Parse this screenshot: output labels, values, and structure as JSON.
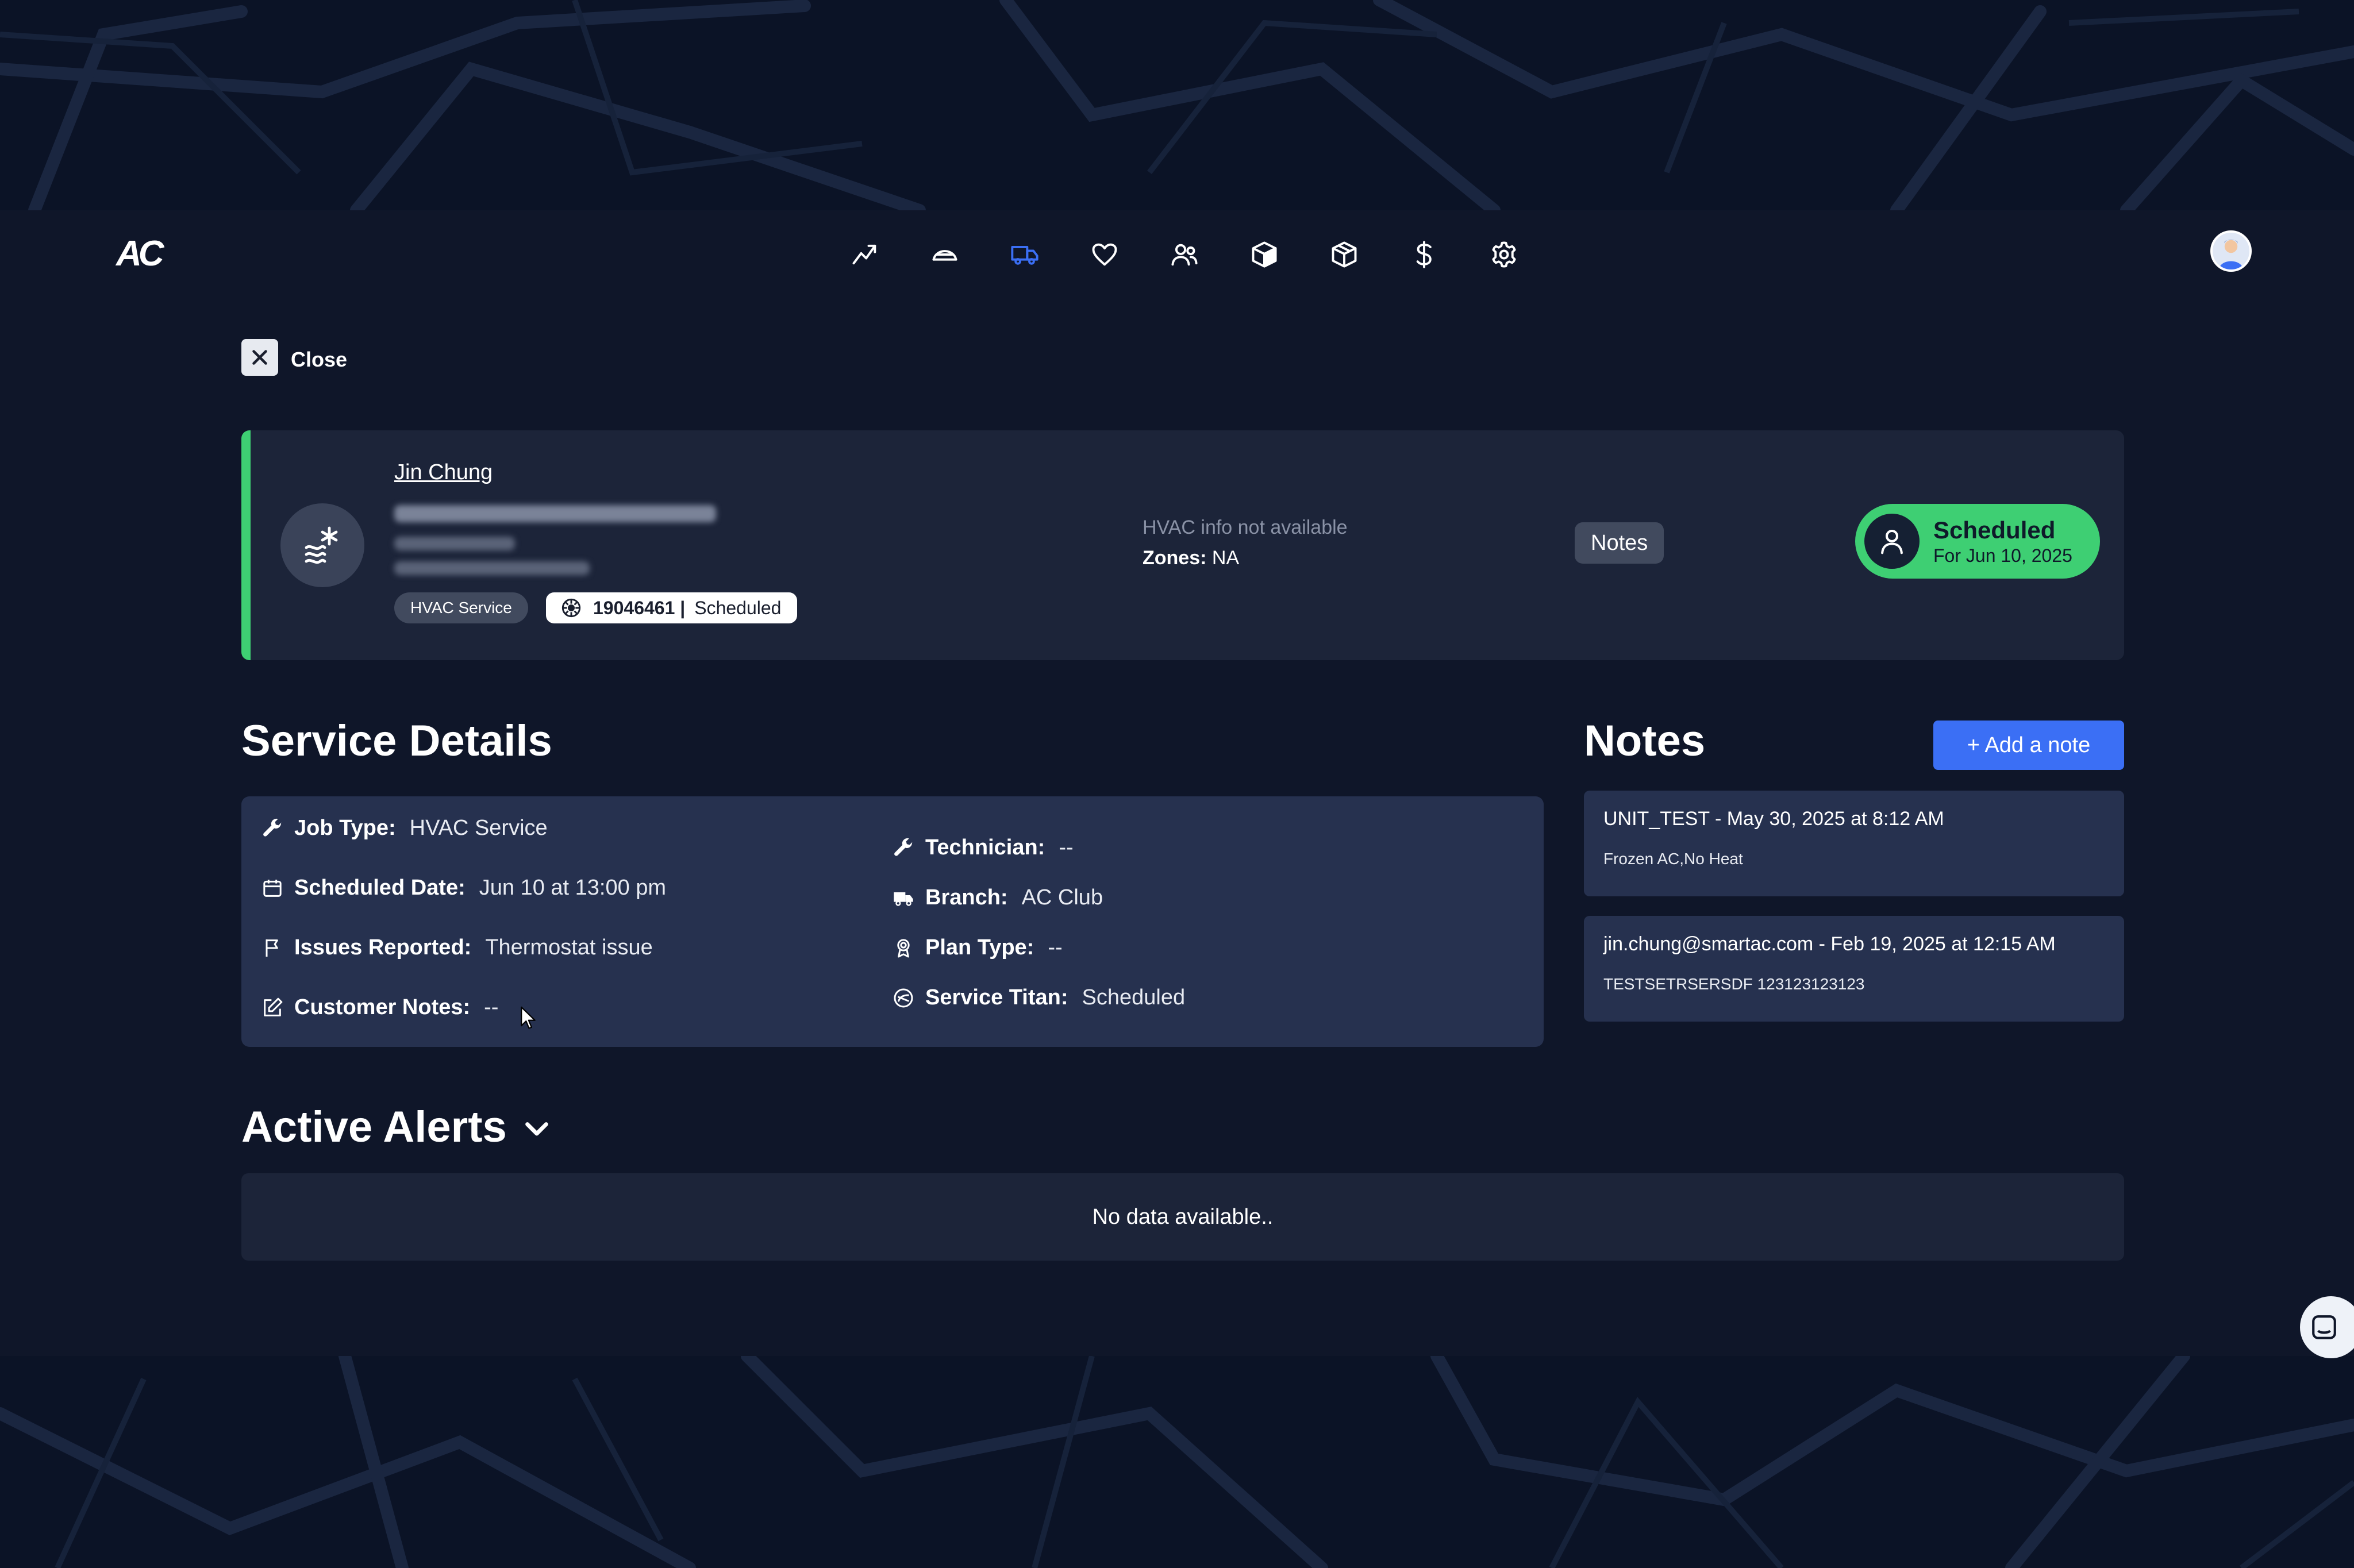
{
  "header": {
    "logo_text": "AC",
    "nav": [
      {
        "icon": "trend-chart-icon",
        "active": false
      },
      {
        "icon": "hvac-unit-icon",
        "active": false
      },
      {
        "icon": "truck-icon",
        "active": true
      },
      {
        "icon": "heart-icon",
        "active": false
      },
      {
        "icon": "users-icon",
        "active": false
      },
      {
        "icon": "box-filled-icon",
        "active": false
      },
      {
        "icon": "box-outline-icon",
        "active": false
      },
      {
        "icon": "dollar-icon",
        "active": false
      },
      {
        "icon": "gear-icon",
        "active": false
      }
    ],
    "accent_color": "#3b6ff5"
  },
  "close": {
    "label": "Close"
  },
  "customer": {
    "name": "Jin Chung",
    "service_tag": "HVAC Service",
    "job_id": "19046461 |",
    "job_status": "Scheduled",
    "hvac_info": "HVAC info not available",
    "zones_label": "Zones:",
    "zones_value": "NA",
    "notes_chip": "Notes",
    "status": {
      "title": "Scheduled",
      "date": "For Jun 10, 2025",
      "color": "#3ecf73"
    }
  },
  "service_details": {
    "title": "Service Details",
    "left": [
      {
        "label": "Job Type:",
        "value": "HVAC Service",
        "icon": "wrench-icon"
      },
      {
        "label": "Scheduled Date:",
        "value": "Jun 10 at 13:00 pm",
        "icon": "calendar-icon"
      },
      {
        "label": "Issues Reported:",
        "value": "Thermostat issue",
        "icon": "flag-icon"
      },
      {
        "label": "Customer Notes:",
        "value": "--",
        "icon": "edit-icon"
      }
    ],
    "right": [
      {
        "label": "Technician:",
        "value": "--",
        "icon": "wrench-icon"
      },
      {
        "label": "Branch:",
        "value": "AC Club",
        "icon": "truck-icon"
      },
      {
        "label": "Plan Type:",
        "value": "--",
        "icon": "award-icon"
      },
      {
        "label": "Service Titan:",
        "value": "Scheduled",
        "icon": "service-titan-icon"
      }
    ]
  },
  "notes": {
    "title": "Notes",
    "add_label": "+ Add a note",
    "items": [
      {
        "header": "UNIT_TEST - May 30, 2025 at 8:12 AM",
        "body": "Frozen AC,No Heat"
      },
      {
        "header": "jin.chung@smartac.com - Feb 19, 2025 at 12:15 AM",
        "body": "TESTSETRSERSDF 123123123123"
      }
    ]
  },
  "alerts": {
    "title": "Active Alerts",
    "empty_text": "No data available.."
  }
}
